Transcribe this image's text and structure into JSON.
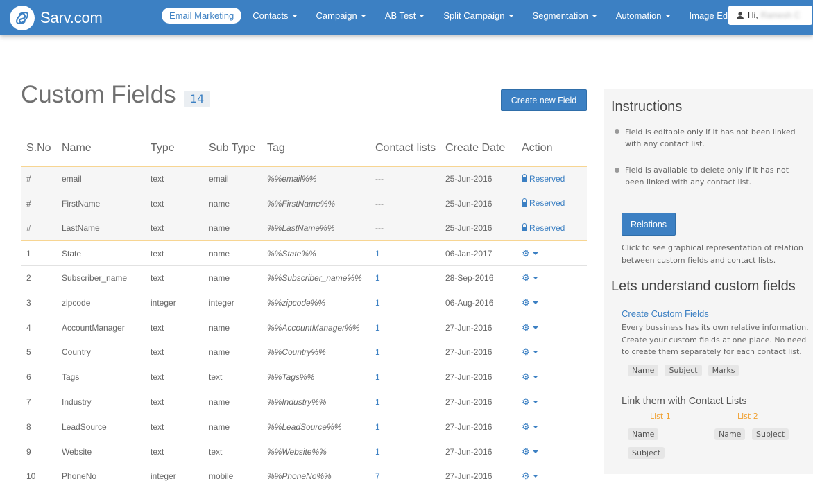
{
  "navbar": {
    "brand": "Sarv.com",
    "items": [
      {
        "label": "Email Marketing",
        "active": true,
        "dropdown": false
      },
      {
        "label": "Contacts",
        "active": false,
        "dropdown": true
      },
      {
        "label": "Campaign",
        "active": false,
        "dropdown": true
      },
      {
        "label": "AB Test",
        "active": false,
        "dropdown": true
      },
      {
        "label": "Split Campaign",
        "active": false,
        "dropdown": true
      },
      {
        "label": "Segmentation",
        "active": false,
        "dropdown": true
      },
      {
        "label": "Automation",
        "active": false,
        "dropdown": true
      },
      {
        "label": "Image Editor",
        "active": false,
        "dropdown": false
      }
    ],
    "user": {
      "greeting": "Hi,",
      "name": "Ramesh C",
      "icon": "user-icon"
    }
  },
  "main": {
    "title": "Custom Fields",
    "count": "14",
    "create_button": "Create new Field",
    "table": {
      "headers": [
        "S.No",
        "Name",
        "Type",
        "Sub Type",
        "Tag",
        "Contact lists",
        "Create Date",
        "Action"
      ],
      "reserved_label": "Reserved",
      "rows": [
        {
          "sno": "#",
          "name": "email",
          "type": "text",
          "subtype": "email",
          "tag": "%%email%%",
          "lists": "---",
          "date": "25-Jun-2016",
          "reserved": true
        },
        {
          "sno": "#",
          "name": "FirstName",
          "type": "text",
          "subtype": "name",
          "tag": "%%FirstName%%",
          "lists": "---",
          "date": "25-Jun-2016",
          "reserved": true
        },
        {
          "sno": "#",
          "name": "LastName",
          "type": "text",
          "subtype": "name",
          "tag": "%%LastName%%",
          "lists": "---",
          "date": "25-Jun-2016",
          "reserved": true
        },
        {
          "sno": "1",
          "name": "State",
          "type": "text",
          "subtype": "name",
          "tag": "%%State%%",
          "lists": "1",
          "date": "06-Jan-2017",
          "reserved": false
        },
        {
          "sno": "2",
          "name": "Subscriber_name",
          "type": "text",
          "subtype": "name",
          "tag": "%%Subscriber_name%%",
          "lists": "1",
          "date": "28-Sep-2016",
          "reserved": false
        },
        {
          "sno": "3",
          "name": "zipcode",
          "type": "integer",
          "subtype": "integer",
          "tag": "%%zipcode%%",
          "lists": "1",
          "date": "06-Aug-2016",
          "reserved": false
        },
        {
          "sno": "4",
          "name": "AccountManager",
          "type": "text",
          "subtype": "name",
          "tag": "%%AccountManager%%",
          "lists": "1",
          "date": "27-Jun-2016",
          "reserved": false
        },
        {
          "sno": "5",
          "name": "Country",
          "type": "text",
          "subtype": "name",
          "tag": "%%Country%%",
          "lists": "1",
          "date": "27-Jun-2016",
          "reserved": false
        },
        {
          "sno": "6",
          "name": "Tags",
          "type": "text",
          "subtype": "text",
          "tag": "%%Tags%%",
          "lists": "1",
          "date": "27-Jun-2016",
          "reserved": false
        },
        {
          "sno": "7",
          "name": "Industry",
          "type": "text",
          "subtype": "name",
          "tag": "%%Industry%%",
          "lists": "1",
          "date": "27-Jun-2016",
          "reserved": false
        },
        {
          "sno": "8",
          "name": "LeadSource",
          "type": "text",
          "subtype": "name",
          "tag": "%%LeadSource%%",
          "lists": "1",
          "date": "27-Jun-2016",
          "reserved": false
        },
        {
          "sno": "9",
          "name": "Website",
          "type": "text",
          "subtype": "text",
          "tag": "%%Website%%",
          "lists": "1",
          "date": "27-Jun-2016",
          "reserved": false
        },
        {
          "sno": "10",
          "name": "PhoneNo",
          "type": "integer",
          "subtype": "mobile",
          "tag": "%%PhoneNo%%",
          "lists": "7",
          "date": "27-Jun-2016",
          "reserved": false
        }
      ]
    }
  },
  "sidebar": {
    "instructions_title": "Instructions",
    "instructions": [
      "Field is editable only if it has not been linked with any contact list.",
      "Field is available to delete only if it has not been linked with any contact list."
    ],
    "relations_button": "Relations",
    "relations_help": "Click to see graphical representation of relation between custom fields and contact lists.",
    "understand_title": "Lets understand custom fields",
    "create_link": "Create Custom Fields",
    "create_desc": "Every bussiness has its own relative information. Create your custom fields at one place. No need to create them separately for each contact list.",
    "example_fields": [
      "Name",
      "Subject",
      "Marks"
    ],
    "link_title": "Link them with Contact Lists",
    "list1": {
      "label": "List 1",
      "fields": [
        "Name",
        "Subject"
      ]
    },
    "list2": {
      "label": "List 2",
      "fields": [
        "Name",
        "Subject"
      ]
    }
  }
}
